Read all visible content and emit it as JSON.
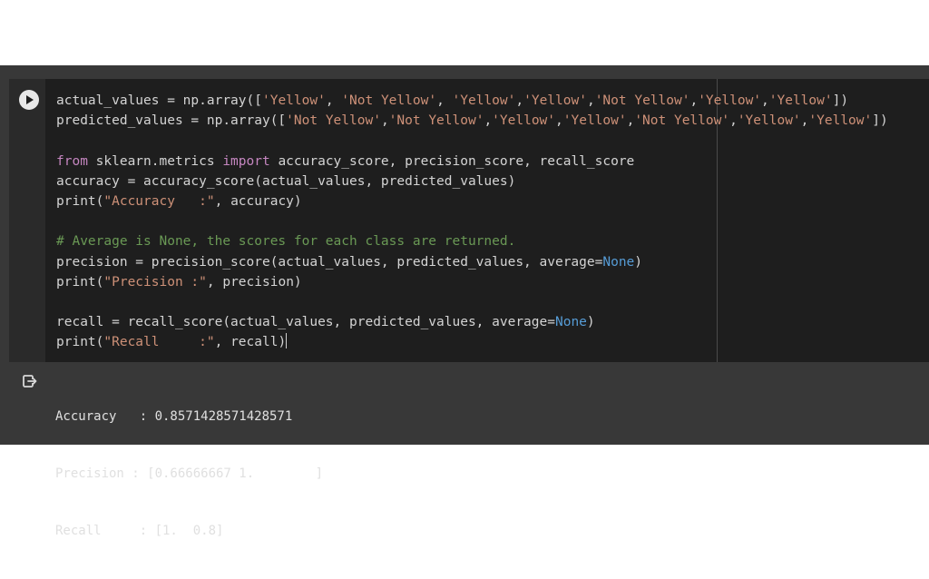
{
  "cell": {
    "code_lines": [
      [
        {
          "t": "plain",
          "v": "actual_values = np.array(["
        },
        {
          "t": "str",
          "v": "'Yellow'"
        },
        {
          "t": "plain",
          "v": ", "
        },
        {
          "t": "str",
          "v": "'Not Yellow'"
        },
        {
          "t": "plain",
          "v": ", "
        },
        {
          "t": "str",
          "v": "'Yellow'"
        },
        {
          "t": "plain",
          "v": ","
        },
        {
          "t": "str",
          "v": "'Yellow'"
        },
        {
          "t": "plain",
          "v": ","
        },
        {
          "t": "str",
          "v": "'Not Yellow'"
        },
        {
          "t": "plain",
          "v": ","
        },
        {
          "t": "str",
          "v": "'Yellow'"
        },
        {
          "t": "plain",
          "v": ","
        },
        {
          "t": "str",
          "v": "'Yellow'"
        },
        {
          "t": "plain",
          "v": "])"
        }
      ],
      [
        {
          "t": "plain",
          "v": "predicted_values = np.array(["
        },
        {
          "t": "str",
          "v": "'Not Yellow'"
        },
        {
          "t": "plain",
          "v": ","
        },
        {
          "t": "str",
          "v": "'Not Yellow'"
        },
        {
          "t": "plain",
          "v": ","
        },
        {
          "t": "str",
          "v": "'Yellow'"
        },
        {
          "t": "plain",
          "v": ","
        },
        {
          "t": "str",
          "v": "'Yellow'"
        },
        {
          "t": "plain",
          "v": ","
        },
        {
          "t": "str",
          "v": "'Not Yellow'"
        },
        {
          "t": "plain",
          "v": ","
        },
        {
          "t": "str",
          "v": "'Yellow'"
        },
        {
          "t": "plain",
          "v": ","
        },
        {
          "t": "str",
          "v": "'Yellow'"
        },
        {
          "t": "plain",
          "v": "])"
        }
      ],
      [],
      [
        {
          "t": "kw",
          "v": "from"
        },
        {
          "t": "plain",
          "v": " sklearn.metrics "
        },
        {
          "t": "kw",
          "v": "import"
        },
        {
          "t": "plain",
          "v": " accuracy_score, precision_score, recall_score"
        }
      ],
      [
        {
          "t": "plain",
          "v": "accuracy = accuracy_score(actual_values, predicted_values)"
        }
      ],
      [
        {
          "t": "plain",
          "v": "print("
        },
        {
          "t": "str",
          "v": "\"Accuracy   :\""
        },
        {
          "t": "plain",
          "v": ", accuracy)"
        }
      ],
      [],
      [
        {
          "t": "com",
          "v": "# Average is None, the scores for each class are returned."
        }
      ],
      [
        {
          "t": "plain",
          "v": "precision = precision_score(actual_values, predicted_values, average="
        },
        {
          "t": "const",
          "v": "None"
        },
        {
          "t": "plain",
          "v": ")"
        }
      ],
      [
        {
          "t": "plain",
          "v": "print("
        },
        {
          "t": "str",
          "v": "\"Precision :\""
        },
        {
          "t": "plain",
          "v": ", precision)"
        }
      ],
      [],
      [
        {
          "t": "plain",
          "v": "recall = recall_score(actual_values, predicted_values, average="
        },
        {
          "t": "const",
          "v": "None"
        },
        {
          "t": "plain",
          "v": ")"
        }
      ],
      [
        {
          "t": "plain",
          "v": "print("
        },
        {
          "t": "str",
          "v": "\"Recall     :\""
        },
        {
          "t": "plain",
          "v": ", recall)"
        }
      ]
    ]
  },
  "output": {
    "lines": [
      "Accuracy   : 0.8571428571428571",
      "Precision : [0.66666667 1.        ]",
      "Recall     : [1.  0.8]"
    ]
  },
  "icons": {
    "run": "play-icon",
    "output": "output-redirect-icon"
  },
  "colors": {
    "string": "#ce9178",
    "keyword": "#c586c0",
    "comment": "#6a9955",
    "constant": "#569cd6",
    "text": "#d4d4d4"
  }
}
